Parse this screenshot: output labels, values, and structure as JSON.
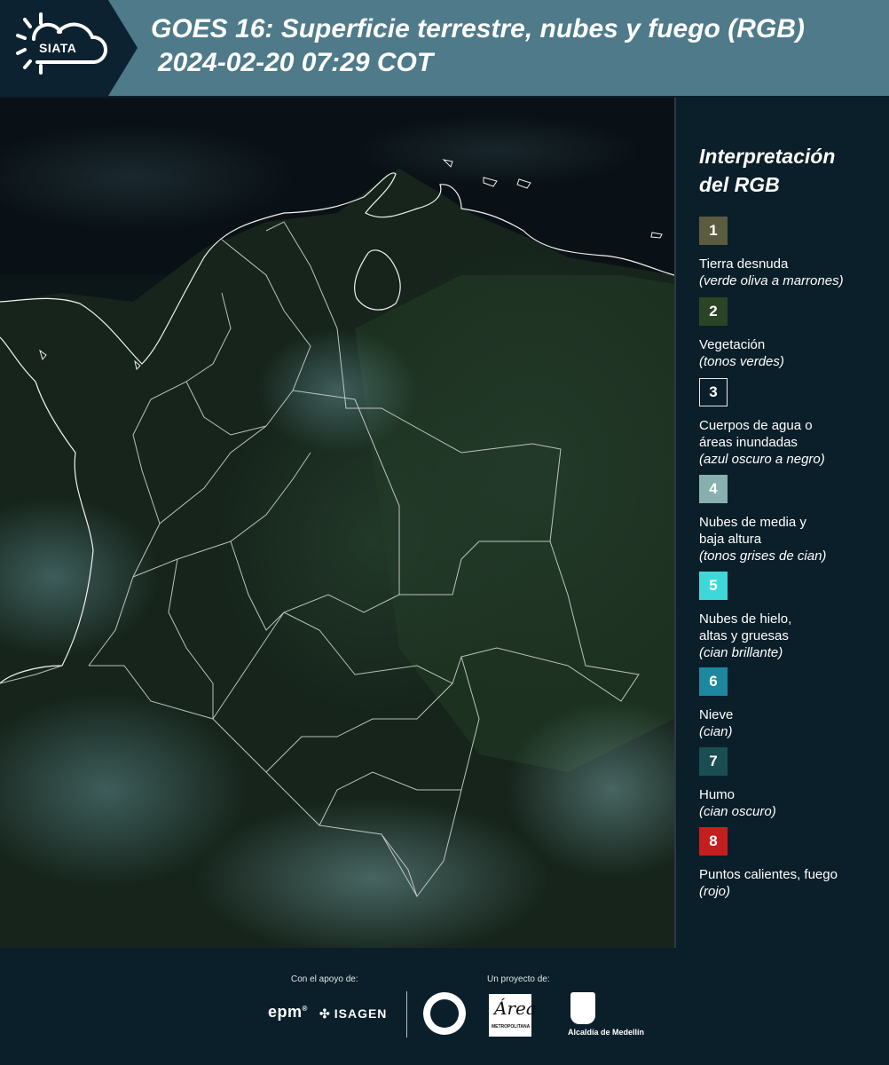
{
  "header": {
    "logo_text": "SIATA",
    "title_line1": "GOES 16: Superficie terrestre, nubes y fuego (RGB)",
    "title_line2": "2024-02-20 07:29 COT"
  },
  "legend": {
    "title_line1": "Interpretación",
    "title_line2": "del RGB",
    "items": [
      {
        "number": "1",
        "label": "Tierra desnuda",
        "sub": "(verde oliva a marrones)",
        "color": "#5b5b40"
      },
      {
        "number": "2",
        "label": "Vegetación",
        "sub": "(tonos verdes)",
        "color": "#2c4426"
      },
      {
        "number": "3",
        "label": "Cuerpos de agua o áreas inundadas",
        "sub": "(azul oscuro a negro)",
        "color": "#0b1f2a"
      },
      {
        "number": "4",
        "label": "Nubes de media y baja altura",
        "sub": "(tonos grises de cian)",
        "color": "#88b0ae"
      },
      {
        "number": "5",
        "label": "Nubes de hielo, altas y gruesas",
        "sub": "(cian brillante)",
        "color": "#3fd8d8"
      },
      {
        "number": "6",
        "label": "Nieve",
        "sub": "(cian)",
        "color": "#1e87a0"
      },
      {
        "number": "7",
        "label": "Humo",
        "sub": "(cian oscuro)",
        "color": "#1b4e52"
      },
      {
        "number": "8",
        "label": "Puntos calientes, fuego",
        "sub": "(rojo)",
        "color": "#c41e1e"
      }
    ]
  },
  "footer": {
    "support_label": "Con el apoyo de:",
    "project_label": "Un proyecto de:",
    "epm": "epm",
    "isagen": "ISAGEN",
    "area_text": "Área",
    "area_sub": "METROPOLITANA",
    "medellin": "Alcaldía de Medellín"
  }
}
